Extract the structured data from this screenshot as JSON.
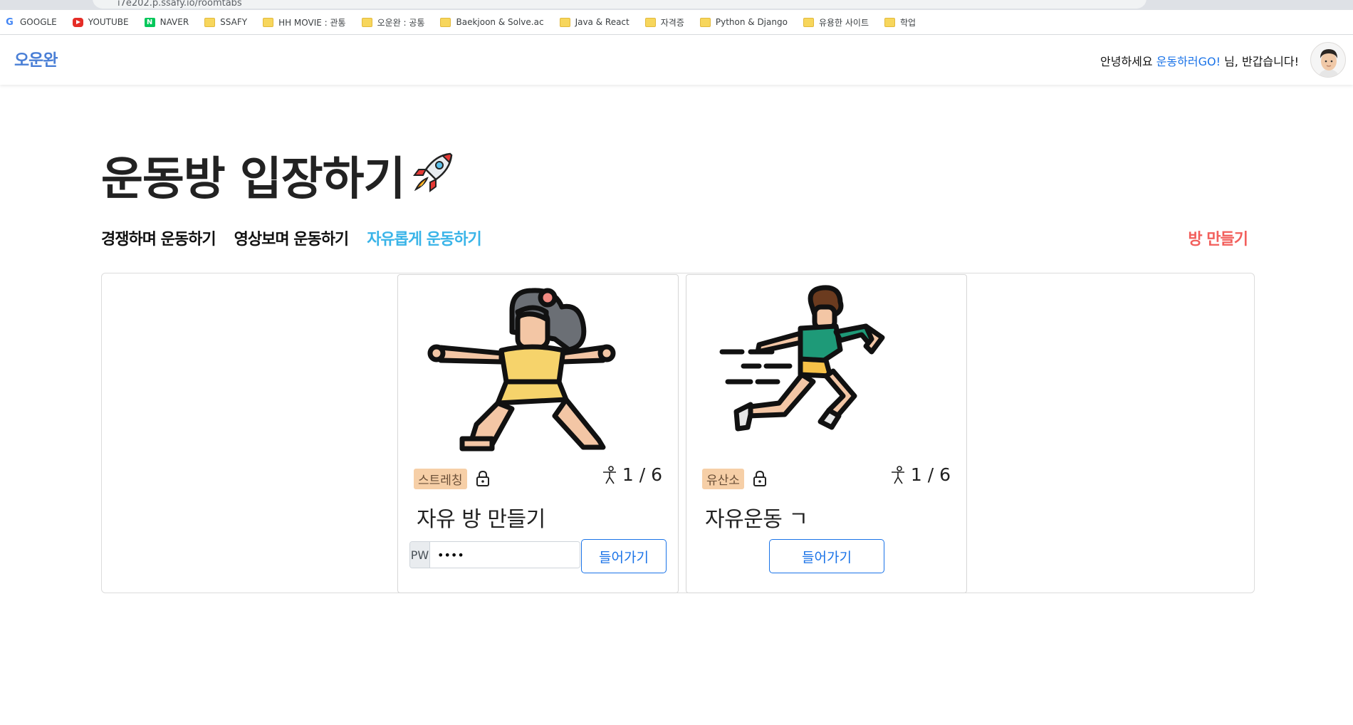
{
  "browser": {
    "url": "i7e202.p.ssafy.io/roomtabs",
    "bookmarks": [
      {
        "label": "GOOGLE",
        "icon": "google-icon"
      },
      {
        "label": "YOUTUBE",
        "icon": "youtube-icon"
      },
      {
        "label": "NAVER",
        "icon": "naver-icon"
      },
      {
        "label": "SSAFY",
        "icon": "folder-icon"
      },
      {
        "label": "HH MOVIE : 관통",
        "icon": "folder-icon"
      },
      {
        "label": "오운완 : 공통",
        "icon": "folder-icon"
      },
      {
        "label": "Baekjoon & Solve.ac",
        "icon": "folder-icon"
      },
      {
        "label": "Java & React",
        "icon": "folder-icon"
      },
      {
        "label": "자격증",
        "icon": "folder-icon"
      },
      {
        "label": "Python & Django",
        "icon": "folder-icon"
      },
      {
        "label": "유용한 사이트",
        "icon": "folder-icon"
      },
      {
        "label": "학업",
        "icon": "folder-icon"
      }
    ]
  },
  "header": {
    "logo": "오운완",
    "greeting_prefix": "안녕하세요 ",
    "username": "운동하러GO!",
    "greeting_suffix": " 님, 반갑습니다!"
  },
  "page": {
    "title": "운동방 입장하기",
    "tabs": [
      {
        "label": "경쟁하며 운동하기",
        "active": false
      },
      {
        "label": "영상보며 운동하기",
        "active": false
      },
      {
        "label": "자유롭게 운동하기",
        "active": true
      }
    ],
    "make_room": "방 만들기"
  },
  "rooms": [
    {
      "tag": "스트레칭",
      "count": "1 / 6",
      "title": "자유 방 만들기",
      "pw_label": "PW",
      "pw_value": "••••",
      "enter": "들어가기"
    },
    {
      "tag": "유산소",
      "count": "1 / 6",
      "title": "자유운동 ㄱ",
      "enter": "들어가기"
    }
  ],
  "colors": {
    "accent_tab": "#3ab4e8",
    "make_room": "#f25f5c",
    "button": "#1a73e8",
    "tag_bg": "#f6cfa7"
  }
}
